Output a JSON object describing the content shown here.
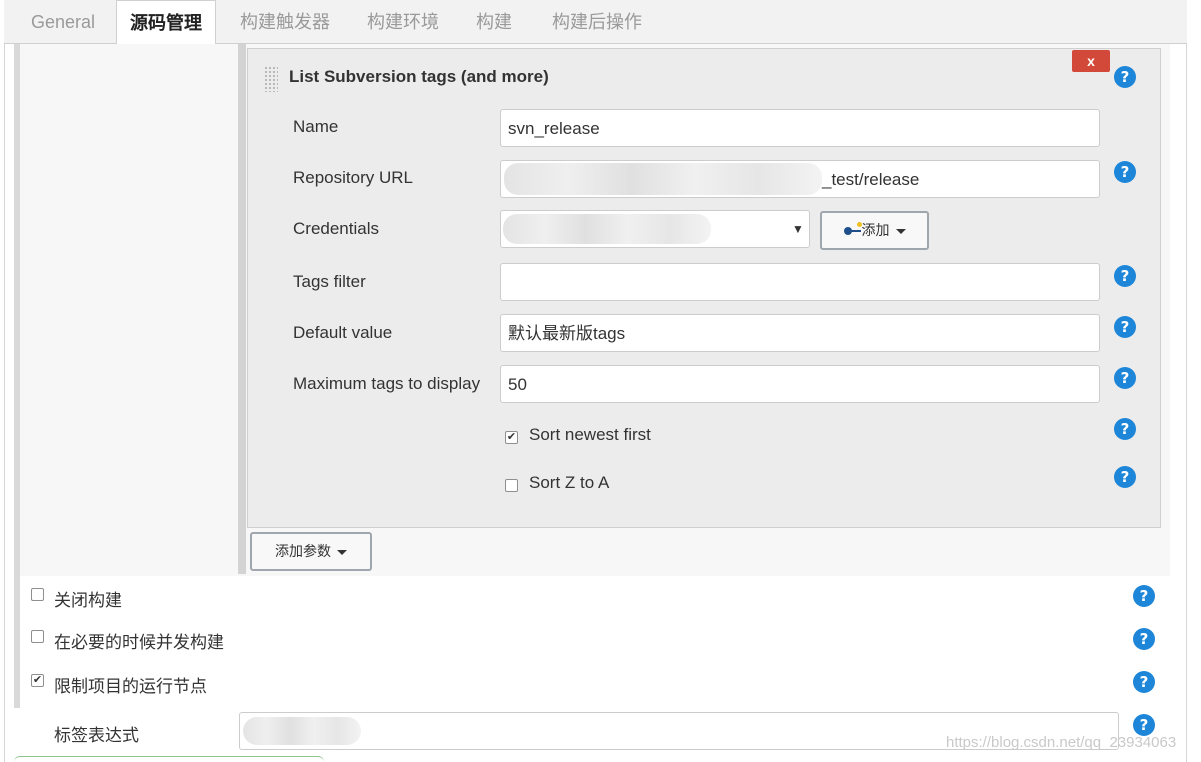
{
  "tabs": [
    "General",
    "源码管理",
    "构建触发器",
    "构建环境",
    "构建",
    "构建后操作"
  ],
  "param": {
    "title": "List Subversion tags (and more)",
    "delete_label": "x",
    "help_glyph": "?",
    "fields": {
      "name_label": "Name",
      "name_value": "svn_release",
      "repo_label": "Repository URL",
      "repo_value_visible": "_test/release",
      "cred_label": "Credentials",
      "add_label": "添加",
      "tags_filter_label": "Tags filter",
      "tags_filter_value": "",
      "default_label": "Default value",
      "default_value": "默认最新版tags",
      "max_label": "Maximum tags to display",
      "max_value": "50",
      "sort_newest_label": "Sort newest first",
      "sort_newest_checked": true,
      "sort_za_label": "Sort Z to A",
      "sort_za_checked": false
    }
  },
  "add_param_label": "添加参数",
  "options": {
    "disable_build_label": "关闭构建",
    "disable_build_checked": false,
    "concurrent_label": "在必要的时候并发构建",
    "concurrent_checked": false,
    "restrict_label": "限制项目的运行节点",
    "restrict_checked": true,
    "label_expr_label": "标签表达式"
  },
  "watermark": "https://blog.csdn.net/qq_23934063",
  "icons": {
    "help": "help-icon",
    "key": "key-icon",
    "drag": "drag-handle-icon",
    "check": "✔"
  },
  "colors": {
    "help_blue": "#1d86d8",
    "delete_red": "#d24939",
    "tab_bar_bg": "#f2f2f2"
  }
}
